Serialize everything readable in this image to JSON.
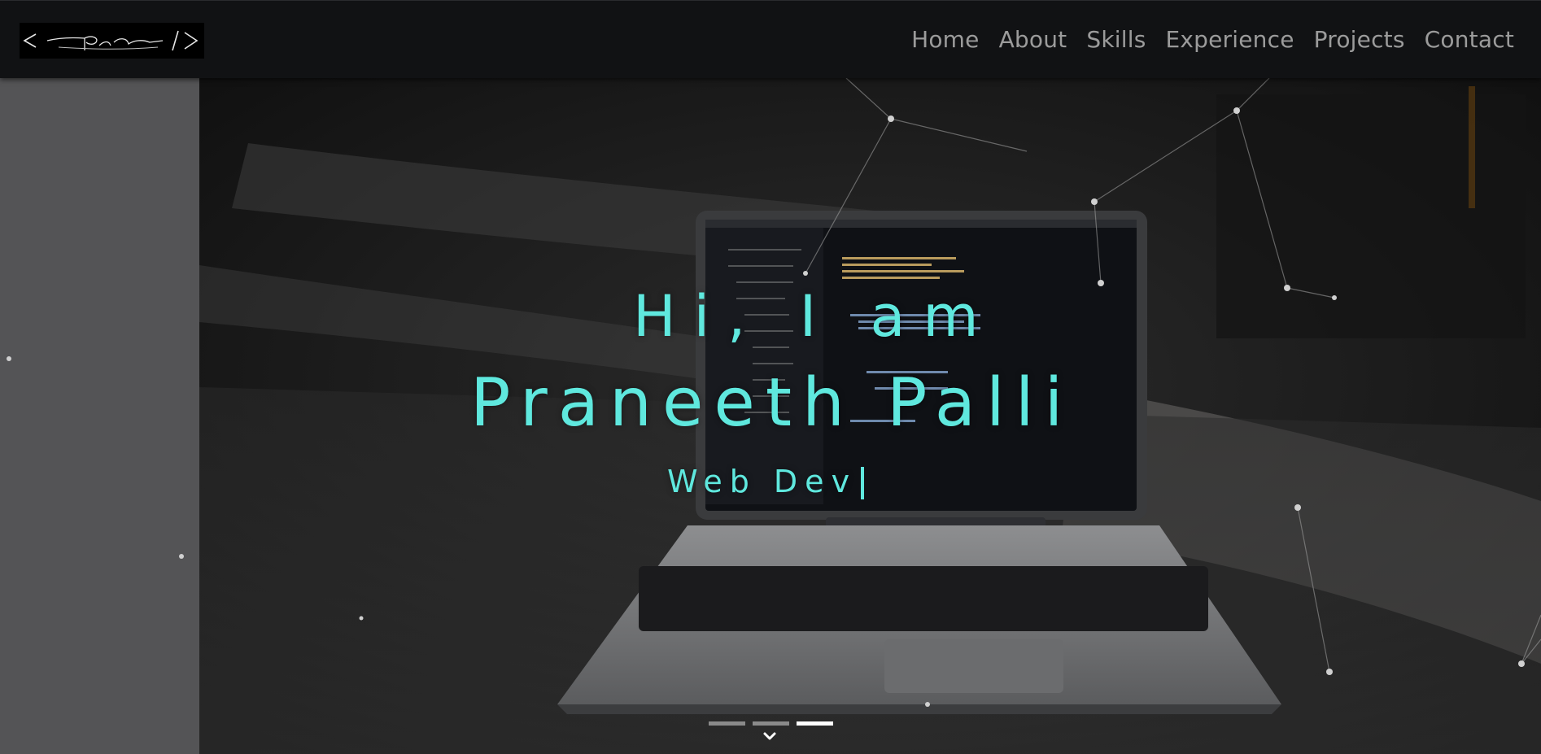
{
  "navbar": {
    "logo": {
      "icon": "signature-logo"
    },
    "links": [
      {
        "label": "Home"
      },
      {
        "label": "About"
      },
      {
        "label": "Skills"
      },
      {
        "label": "Experience"
      },
      {
        "label": "Projects"
      },
      {
        "label": "Contact"
      }
    ]
  },
  "hero": {
    "greeting": "Hi, I am",
    "name": "Praneeth Palli",
    "role": "Web Dev",
    "accent_color": "#5fe8de",
    "background_image": "laptop-with-code-on-dark-floor",
    "carousel": {
      "active_index": 3,
      "count": 3
    },
    "scroll_icon": "chevron-down-icon"
  },
  "colors": {
    "nav_bg": "#111214",
    "nav_text": "#9b9b9b",
    "side_strip": "#545456"
  }
}
